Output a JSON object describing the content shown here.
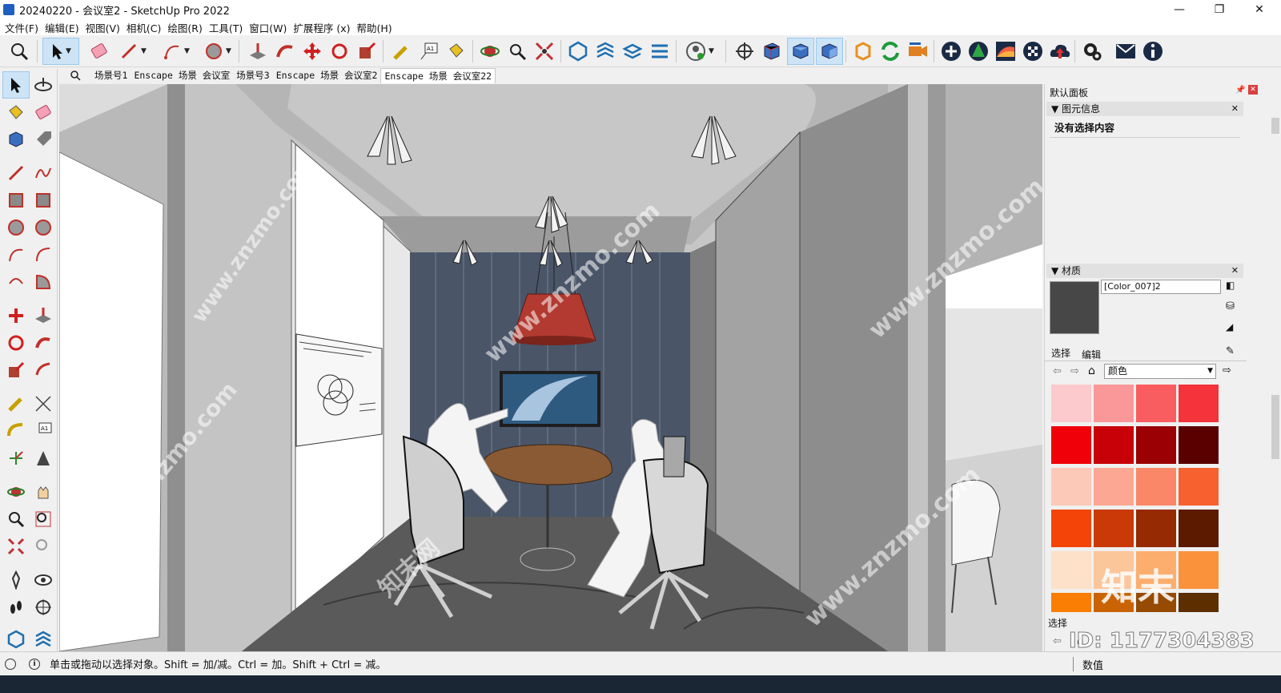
{
  "window": {
    "title": "20240220 - 会议室2 - SketchUp Pro 2022",
    "app_icon": "sketchup-icon",
    "controls": [
      "—",
      "❐",
      "✕"
    ]
  },
  "menu": [
    "文件(F)",
    "编辑(E)",
    "视图(V)",
    "相机(C)",
    "绘图(R)",
    "工具(T)",
    "窗口(W)",
    "扩展程序 (x)",
    "帮助(H)"
  ],
  "toolbar": {
    "tools": [
      "zoom-icon",
      "select-icon",
      "eraser-icon",
      "pencil-icon",
      "arc-icon",
      "circle-icon",
      "push-pull-icon",
      "follow-me-icon",
      "move-icon",
      "rotate-icon",
      "scale-icon",
      "tape-measure-icon",
      "text-icon",
      "paint-bucket-icon",
      "orbit-icon",
      "zoom-window-icon",
      "zoom-extents-icon",
      "sandbox-icon",
      "section-icon",
      "layers-icon",
      "component-icon",
      "user-icon",
      "crosshair-icon",
      "iso-view-icon",
      "top-view-icon",
      "front-view-icon",
      "enscape-logo-icon",
      "refresh-icon",
      "video-icon",
      "add-icon",
      "tree-icon",
      "sun-icon",
      "checker-icon",
      "upload-icon",
      "settings-icon",
      "mail-icon",
      "info-icon"
    ]
  },
  "scene_tabs": [
    "场景号1",
    "Enscape 场景 会议室",
    "场景号3",
    "Enscape 场景 会议室2",
    "Enscape 场景 会议室22"
  ],
  "active_tab": "Enscape 场景 会议室22",
  "panel": {
    "title": "默认面板",
    "entity_info": {
      "header": "图元信息",
      "empty_text": "没有选择内容"
    },
    "materials": {
      "header": "材质",
      "material_name": "[Color_007]2",
      "preview_color": "#474747",
      "tabs": [
        "选择",
        "编辑"
      ],
      "library": "颜色",
      "swatches": [
        "#fcc9cc",
        "#fa9799",
        "#f95d5f",
        "#f4333a",
        "#f00008",
        "#c80008",
        "#9a0004",
        "#5a0000",
        "#fcc9b8",
        "#fba793",
        "#f98768",
        "#f7602f",
        "#f54408",
        "#c93a08",
        "#962a02",
        "#5c1a00",
        "#fde1c8",
        "#fcc69b",
        "#fbae6d",
        "#fa923b",
        "#fa7d04",
        "#c96303",
        "#964a02",
        "#5c2e00"
      ],
      "footer_label": "选择",
      "footer_label2": "数值"
    }
  },
  "status": {
    "hint": "单击或拖动以选择对象。Shift = 加/减。Ctrl = 加。Shift + Ctrl = 减。"
  },
  "watermarks": {
    "url": "www.znzmo.com",
    "brand_cn": "知末网",
    "logo_text": "知末",
    "id_text": "ID: 1177304383"
  },
  "scene_colors": {
    "ceiling": "#b9b9b9",
    "back_wall": "#4a5568",
    "side_wall": "#8e8e8e",
    "floor": "#5a5a5a",
    "lamp_shade": "#b23a30",
    "table": "#8a5a34",
    "screen": "#2e5a80"
  }
}
